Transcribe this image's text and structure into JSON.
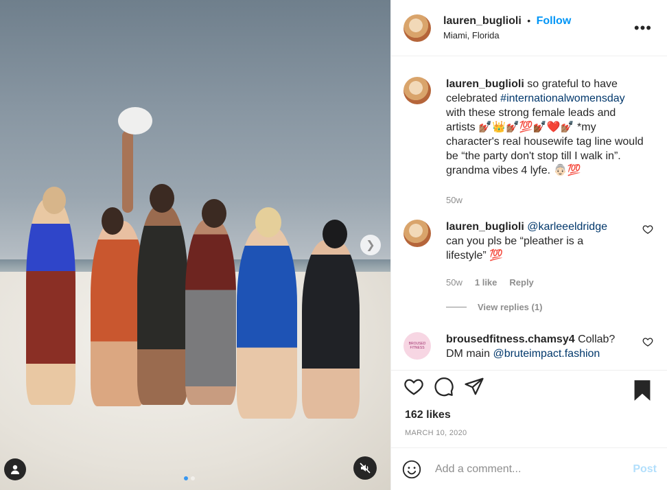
{
  "post": {
    "username": "lauren_buglioli",
    "separator": "•",
    "follow_label": "Follow",
    "location": "Miami, Florida",
    "more_icon": "more-dots-icon"
  },
  "media": {
    "carousel_pages": 2,
    "current_page": 1,
    "next_icon": "chevron-right-icon",
    "tag_icon": "person-icon",
    "mute_icon": "speaker-muted-icon"
  },
  "comments": [
    {
      "user": "lauren_buglioli",
      "text_before": "so grateful to have celebrated ",
      "hashtag": "#internationalwomensday",
      "text_after": " with these strong female leads and artists 💅🏽👑💅🏽💯💅🏾❤️💅🏽 *my character's real housewife tag line would be “the party don't stop till I walk in”. grandma vibes 4 lyfe. 👵🏻💯",
      "age": "50w"
    },
    {
      "user": "lauren_buglioli",
      "mention": "@karleeeldridge",
      "text": " can you pls be “pleather is a lifestyle” 💯",
      "age": "50w",
      "likes": "1 like",
      "reply_label": "Reply",
      "view_replies": "View replies (1)"
    },
    {
      "user": "brousedfitness.chamsy4",
      "avatar_text": "BROUSED FITNESS",
      "text_before": " Collab? DM main ",
      "mention": "@bruteimpact.fashion"
    }
  ],
  "actions": {
    "like_icon": "heart-icon",
    "comment_icon": "comment-icon",
    "share_icon": "send-icon",
    "save_icon": "bookmark-icon"
  },
  "likes": "162 likes",
  "date": "MARCH 10, 2020",
  "add_comment": {
    "emoji_icon": "smiley-icon",
    "placeholder": "Add a comment...",
    "post_label": "Post"
  }
}
